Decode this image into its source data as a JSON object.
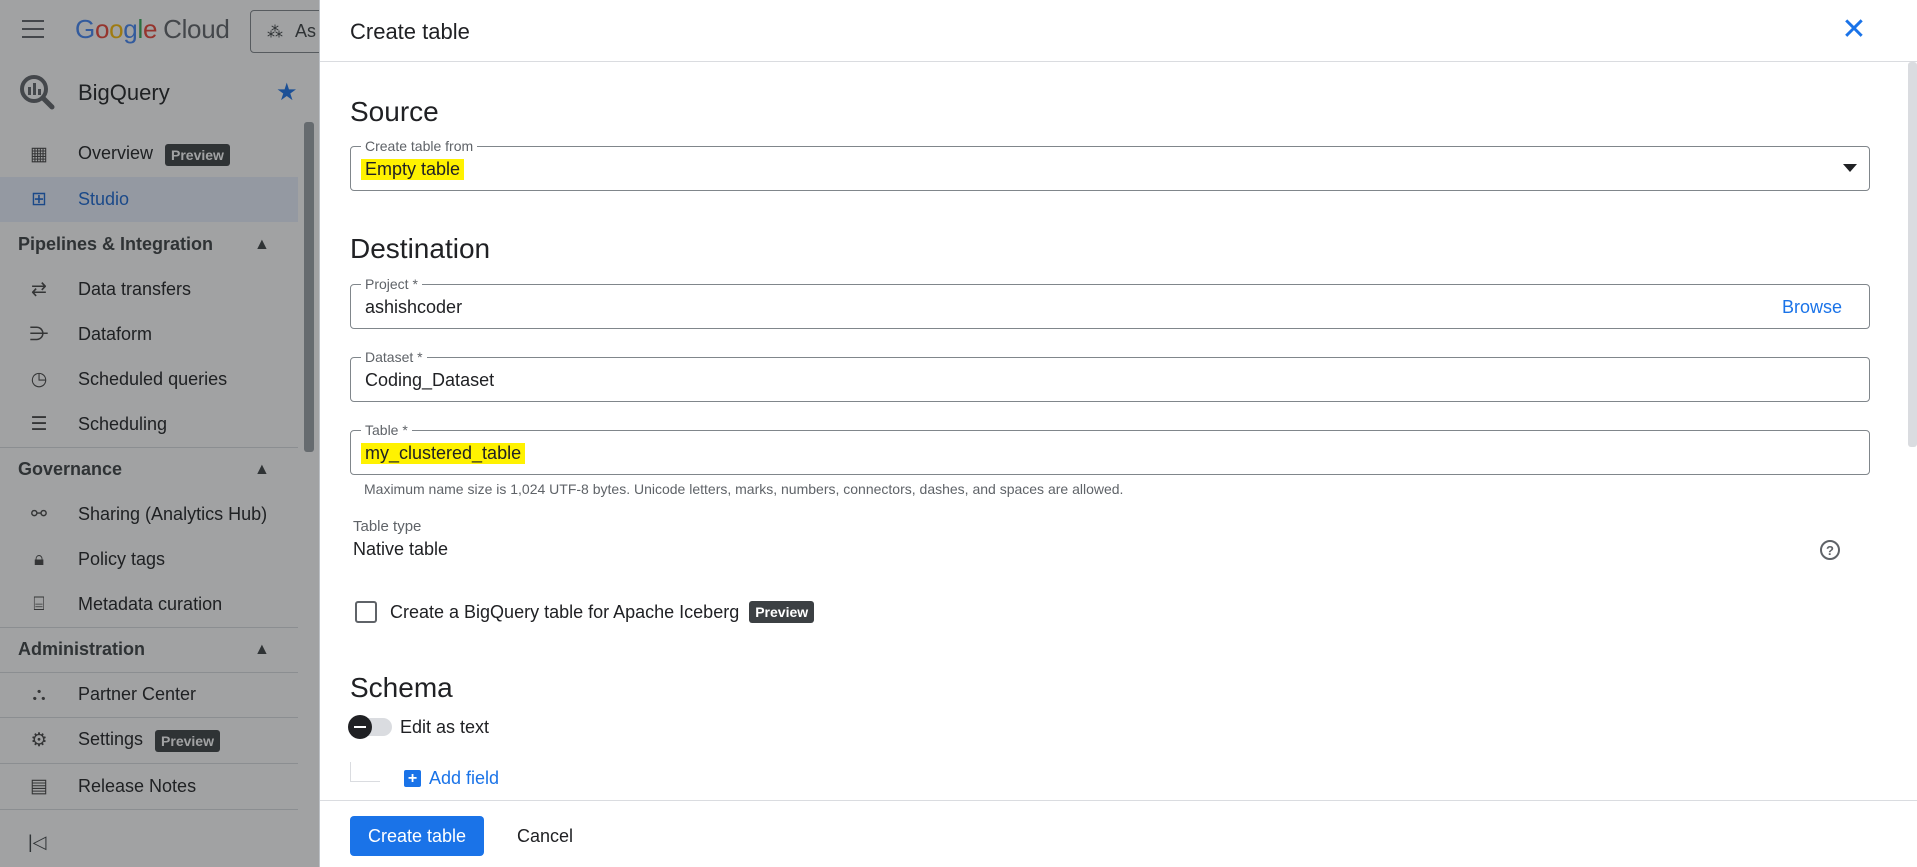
{
  "header": {
    "logo": {
      "g1": "G",
      "g2": "o",
      "g3": "o",
      "g4": "g",
      "g5": "l",
      "g6": "e",
      "product": "Cloud"
    },
    "project_picker": "As"
  },
  "sidebar": {
    "product_title": "BigQuery",
    "items": {
      "overview": {
        "label": "Overview",
        "badge": "Preview"
      },
      "studio": {
        "label": "Studio"
      },
      "data_transfers": {
        "label": "Data transfers"
      },
      "dataform": {
        "label": "Dataform"
      },
      "scheduled_queries": {
        "label": "Scheduled queries"
      },
      "scheduling": {
        "label": "Scheduling"
      },
      "sharing": {
        "label": "Sharing (Analytics Hub)"
      },
      "policy_tags": {
        "label": "Policy tags"
      },
      "metadata_curation": {
        "label": "Metadata curation"
      },
      "partner_center": {
        "label": "Partner Center"
      },
      "settings": {
        "label": "Settings",
        "badge": "Preview"
      },
      "release_notes": {
        "label": "Release Notes"
      }
    },
    "sections": {
      "pipelines": "Pipelines & Integration",
      "governance": "Governance",
      "administration": "Administration"
    }
  },
  "panel": {
    "title": "Create table",
    "source": {
      "heading": "Source",
      "create_from_label": "Create table from",
      "create_from_value": "Empty table"
    },
    "destination": {
      "heading": "Destination",
      "project_label": "Project *",
      "project_value": "ashishcoder",
      "browse_label": "Browse",
      "dataset_label": "Dataset *",
      "dataset_value": "Coding_Dataset",
      "table_label": "Table *",
      "table_value": "my_clustered_table",
      "table_hint": "Maximum name size is 1,024 UTF-8 bytes. Unicode letters, marks, numbers, connectors, dashes, and spaces are allowed.",
      "table_type_label": "Table type",
      "table_type_value": "Native table",
      "iceberg_label": "Create a BigQuery table for Apache Iceberg",
      "iceberg_badge": "Preview"
    },
    "schema": {
      "heading": "Schema",
      "edit_as_text_label": "Edit as text",
      "add_field_label": "Add field"
    },
    "footer": {
      "create_label": "Create table",
      "cancel_label": "Cancel"
    }
  },
  "colors": {
    "accent": "#1a73e8",
    "highlight": "#fff200",
    "badge_bg": "#3c4043"
  }
}
